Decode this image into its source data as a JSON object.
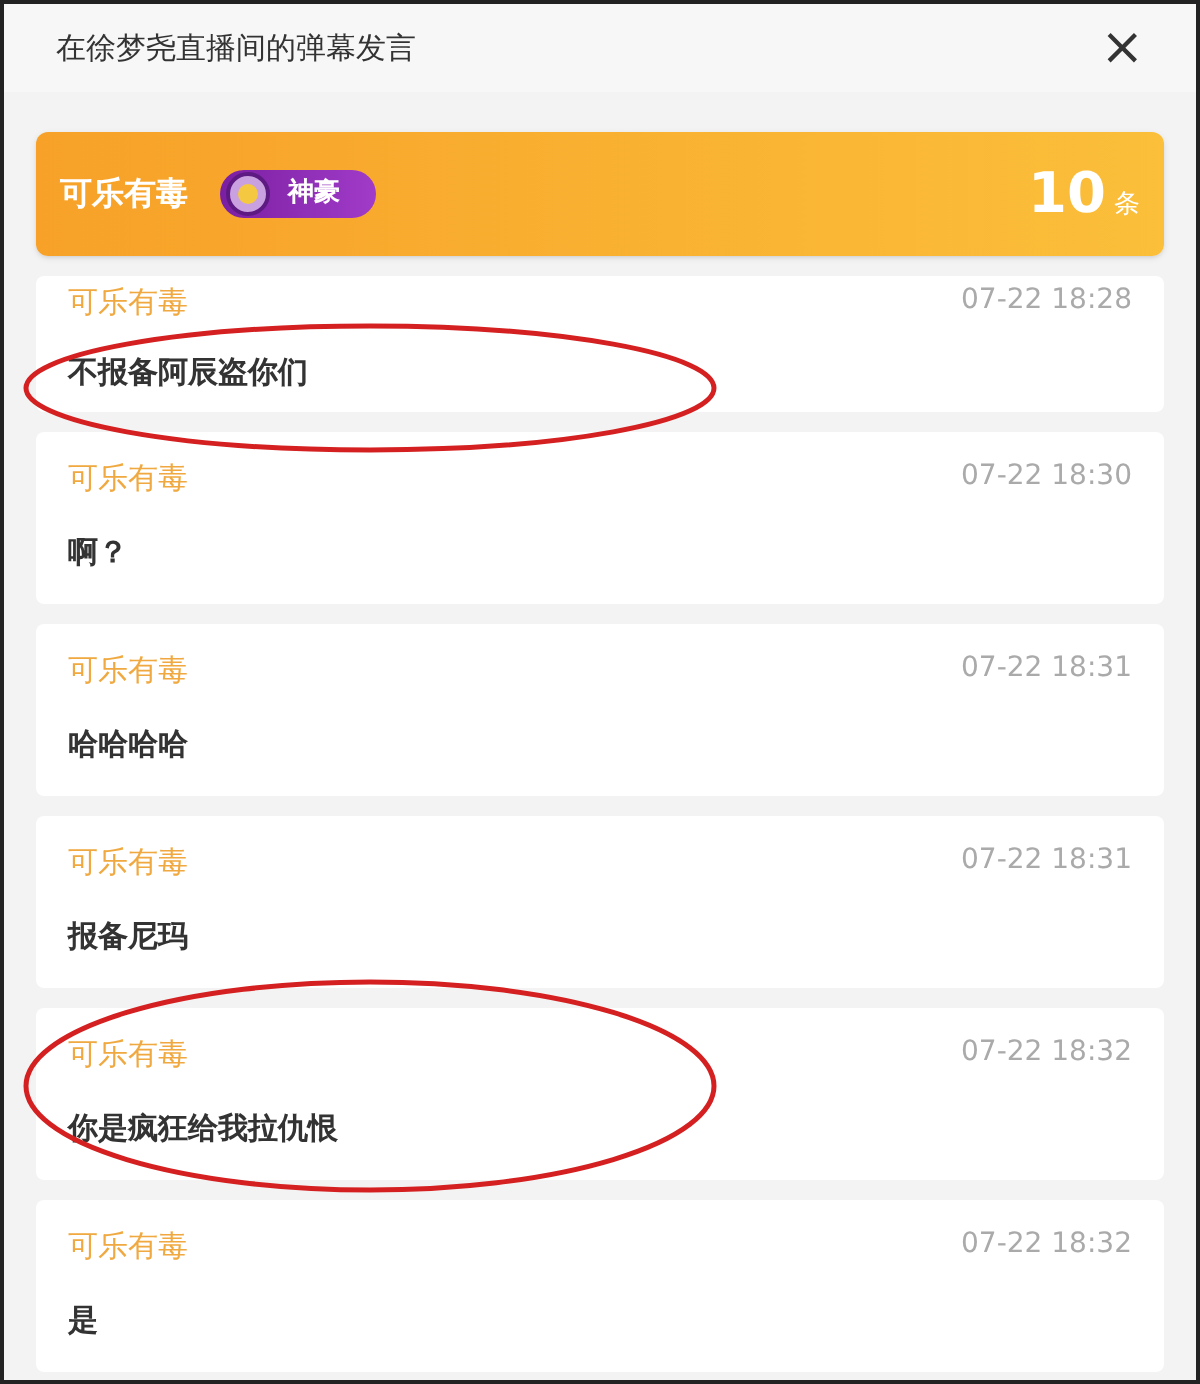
{
  "window": {
    "title": "在徐梦尧直播间的弹幕发言",
    "close": "×"
  },
  "user": {
    "name": "可乐有毒",
    "badge": "神豪",
    "count": "10",
    "unit": "条"
  },
  "messages": [
    {
      "name": "可乐有毒",
      "time": "07-22 18:28",
      "text": "不报备阿辰盗你们",
      "circled": true
    },
    {
      "name": "可乐有毒",
      "time": "07-22 18:30",
      "text": "啊？",
      "circled": false
    },
    {
      "name": "可乐有毒",
      "time": "07-22 18:31",
      "text": "哈哈哈哈",
      "circled": false
    },
    {
      "name": "可乐有毒",
      "time": "07-22 18:31",
      "text": "报备尼玛",
      "circled": false
    },
    {
      "name": "可乐有毒",
      "time": "07-22 18:32",
      "text": "你是疯狂给我拉仇恨",
      "circled": true
    },
    {
      "name": "可乐有毒",
      "time": "07-22 18:32",
      "text": "是",
      "circled": false
    }
  ]
}
